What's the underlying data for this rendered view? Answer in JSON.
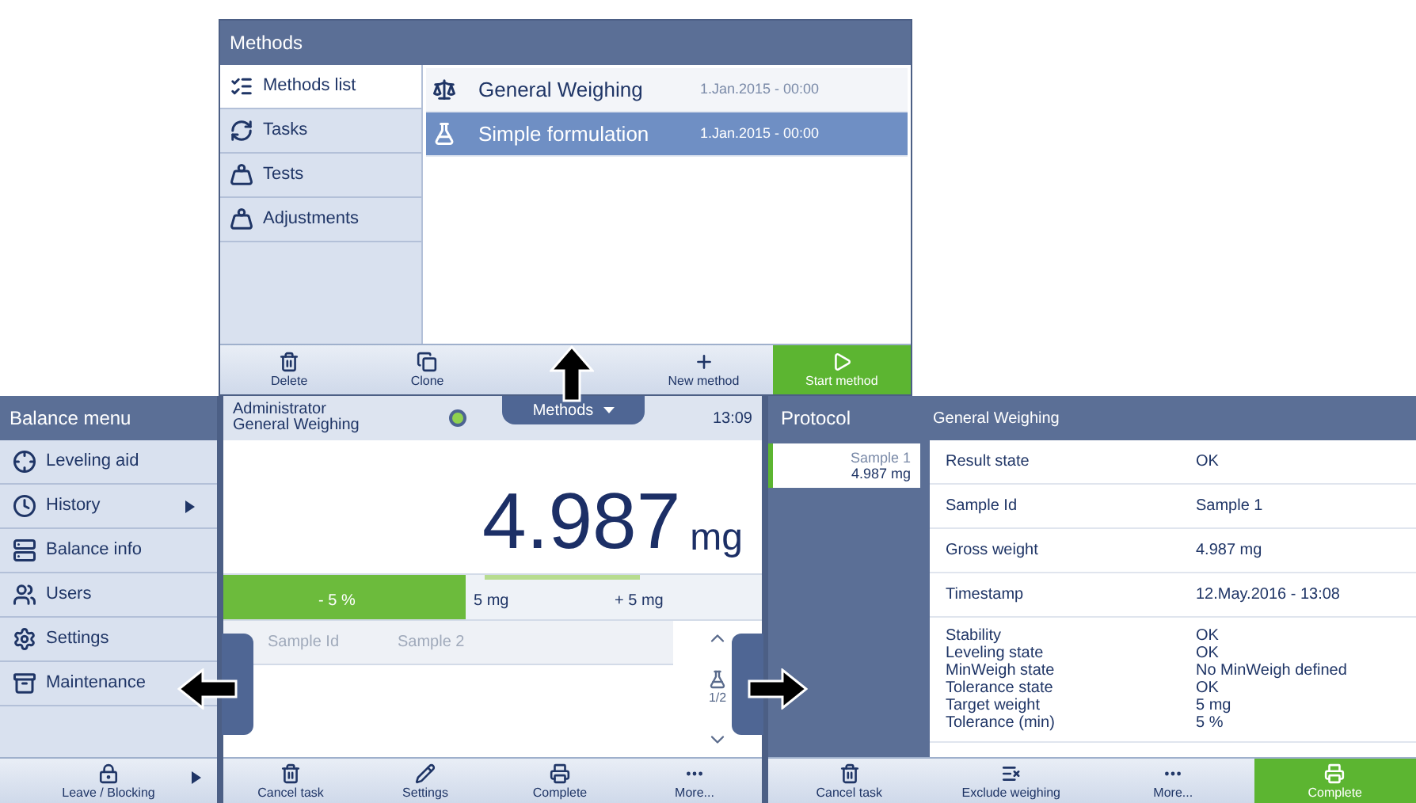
{
  "methods_panel": {
    "title": "Methods",
    "sidebar": [
      {
        "label": "Methods list",
        "selected": true
      },
      {
        "label": "Tasks",
        "selected": false
      },
      {
        "label": "Tests",
        "selected": false
      },
      {
        "label": "Adjustments",
        "selected": false
      }
    ],
    "list": [
      {
        "name": "General Weighing",
        "date": "1.Jan.2015 - 00:00",
        "selected": false
      },
      {
        "name": "Simple formulation",
        "date": "1.Jan.2015 - 00:00",
        "selected": true
      }
    ],
    "toolbar": [
      {
        "label": "Delete",
        "kind": "normal"
      },
      {
        "label": "Clone",
        "kind": "normal"
      },
      {
        "kind": "hidden"
      },
      {
        "label": "New method",
        "kind": "normal"
      },
      {
        "label": "Start method",
        "kind": "primary"
      }
    ]
  },
  "balance_menu": {
    "title": "Balance menu",
    "items": [
      {
        "label": "Leveling aid",
        "submenu": false
      },
      {
        "label": "History",
        "submenu": true
      },
      {
        "label": "Balance info",
        "submenu": false
      },
      {
        "label": "Users",
        "submenu": false
      },
      {
        "label": "Settings",
        "submenu": false
      },
      {
        "label": "Maintenance",
        "submenu": false
      }
    ],
    "footer": {
      "label": "Leave / Blocking",
      "submenu": true
    }
  },
  "weighing_screen": {
    "user": "Administrator",
    "method": "General Weighing",
    "tab": "Methods",
    "time": "13:09",
    "weight": "4.987",
    "unit": "mg",
    "tolerance": {
      "level": 0.45,
      "labels": [
        "- 5 %",
        "5 mg",
        "+ 5 mg"
      ]
    },
    "sample": {
      "label": "Sample Id",
      "placeholder": "Sample 2",
      "page": "1/2"
    },
    "toolbar": [
      {
        "label": "Cancel task",
        "kind": "normal"
      },
      {
        "label": "Settings",
        "kind": "normal"
      },
      {
        "label": "Complete",
        "kind": "normal"
      },
      {
        "label": "More...",
        "kind": "normal"
      }
    ]
  },
  "protocol": {
    "title": "Protocol",
    "subtitle": "General Weighing",
    "samples": [
      {
        "name": "Sample 1",
        "value": "4.987 mg",
        "selected": true
      }
    ],
    "rows": [
      {
        "lines": [
          {
            "label": "Result state",
            "value": "OK"
          }
        ]
      },
      {
        "lines": [
          {
            "label": "Sample Id",
            "value": "Sample 1"
          }
        ]
      },
      {
        "lines": [
          {
            "label": "Gross weight",
            "value": "4.987 mg"
          }
        ]
      },
      {
        "lines": [
          {
            "label": "Timestamp",
            "value": "12.May.2016 - 13:08"
          }
        ]
      },
      {
        "lines": [
          {
            "label": "Stability",
            "value": "OK"
          },
          {
            "label": "Leveling state",
            "value": "OK"
          },
          {
            "label": "MinWeigh state",
            "value": "No MinWeigh defined"
          },
          {
            "label": "Tolerance state",
            "value": "OK"
          },
          {
            "label": "Target weight",
            "value": "5 mg"
          },
          {
            "label": "Tolerance (min)",
            "value": "5 %"
          }
        ]
      }
    ],
    "toolbar": [
      {
        "label": "Cancel task",
        "kind": "normal"
      },
      {
        "label": "Exclude weighing",
        "kind": "normal"
      },
      {
        "label": "More...",
        "kind": "normal"
      },
      {
        "label": "Complete",
        "kind": "primary"
      }
    ]
  }
}
